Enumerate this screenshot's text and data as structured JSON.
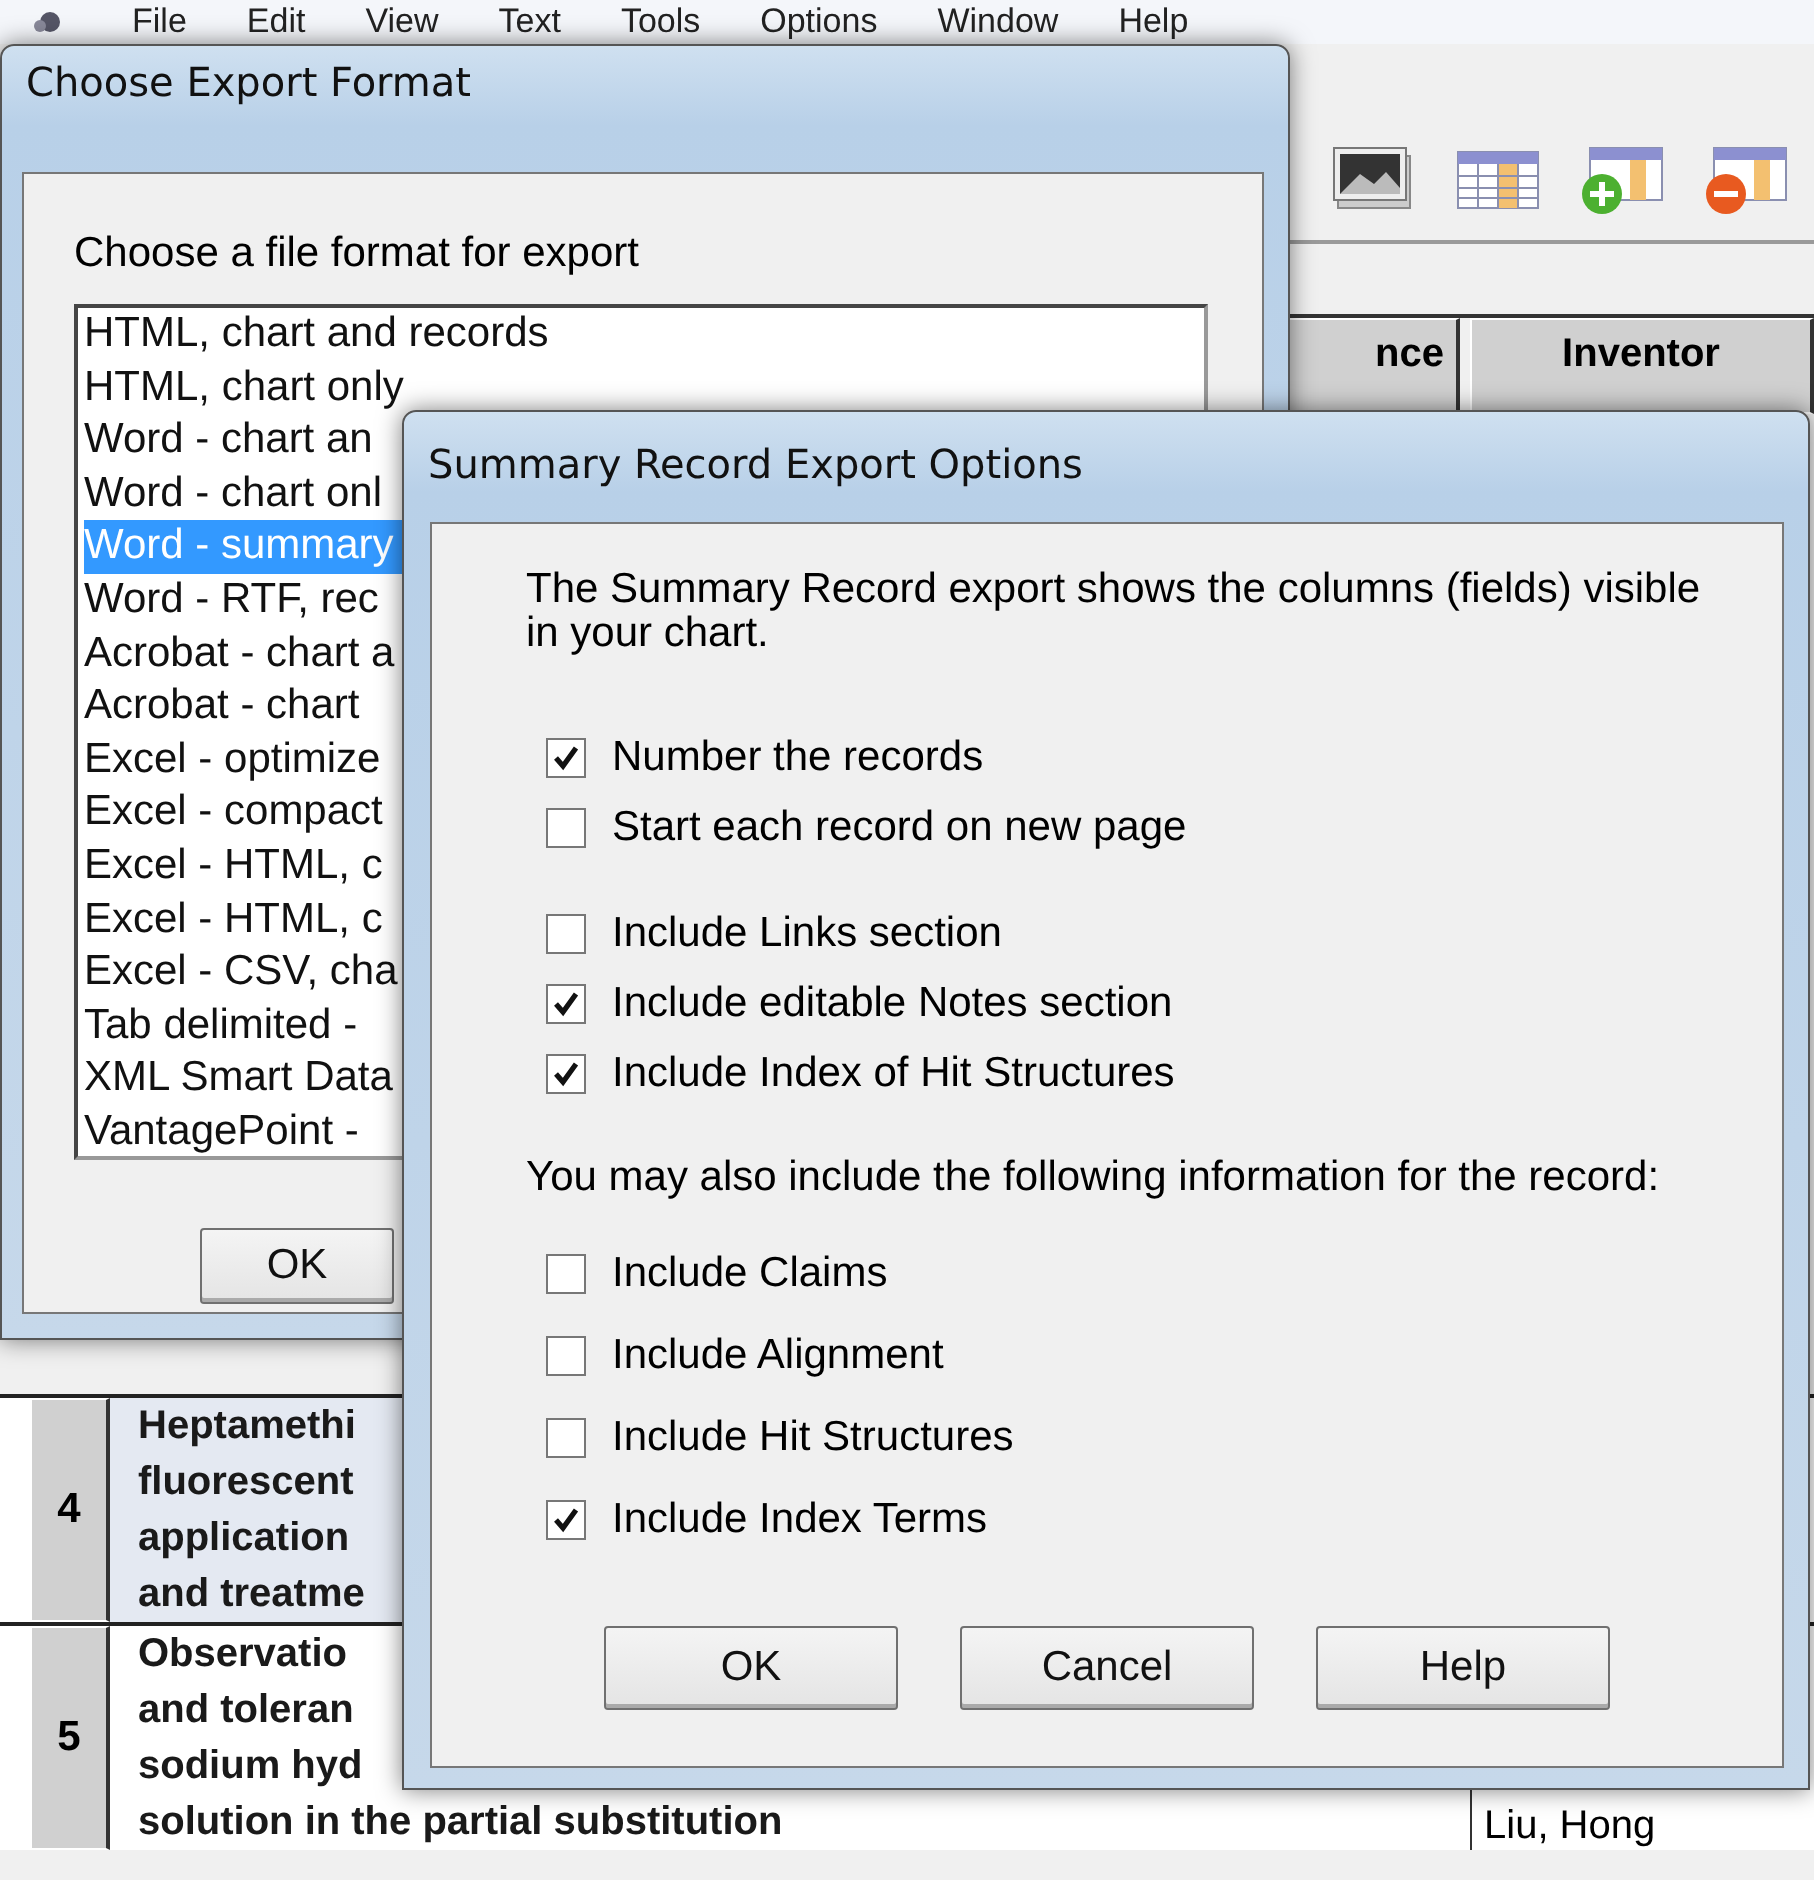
{
  "app": {
    "menu": [
      "File",
      "Edit",
      "View",
      "Text",
      "Tools",
      "Options",
      "Window",
      "Help"
    ],
    "table": {
      "columns": [
        "nce",
        "Inventor"
      ],
      "rows": [
        {
          "number": "4",
          "title_lines": [
            "Heptamethi",
            "fluorescent",
            "application",
            "and treatme"
          ],
          "inventor": "",
          "selected": true
        },
        {
          "number": "5",
          "title_lines": [
            "Observatio",
            "and toleran",
            "sodium hyd",
            "solution in the partial substitution"
          ],
          "inventor": "Liu, Hong",
          "selected": false
        }
      ]
    }
  },
  "export_dialog": {
    "title": "Choose Export Format",
    "prompt": "Choose a file format for export",
    "formats": [
      {
        "label": "HTML, chart and records",
        "selected": false
      },
      {
        "label": "HTML, chart only",
        "selected": false
      },
      {
        "label": "Word - chart an",
        "selected": false
      },
      {
        "label": "Word - chart onl",
        "selected": false
      },
      {
        "label": "Word - summary",
        "selected": true
      },
      {
        "label": "Word - RTF, rec",
        "selected": false
      },
      {
        "label": "Acrobat - chart a",
        "selected": false
      },
      {
        "label": "Acrobat - chart",
        "selected": false
      },
      {
        "label": "Excel - optimize",
        "selected": false
      },
      {
        "label": "Excel - compact",
        "selected": false
      },
      {
        "label": "Excel - HTML, c",
        "selected": false
      },
      {
        "label": "Excel - HTML, c",
        "selected": false
      },
      {
        "label": "Excel - CSV, cha",
        "selected": false
      },
      {
        "label": "Tab delimited -",
        "selected": false
      },
      {
        "label": "XML Smart Data",
        "selected": false
      },
      {
        "label": "VantagePoint -",
        "selected": false
      }
    ],
    "buttons": [
      "OK"
    ]
  },
  "options_dialog": {
    "title": "Summary Record Export Options",
    "description": "The Summary Record export shows the columns (fields) visible in your chart.",
    "sections": [
      {
        "options": [
          {
            "label": "Number the records",
            "checked": true
          },
          {
            "label": "Start each record on new page",
            "checked": false
          }
        ]
      },
      {
        "options": [
          {
            "label": "Include Links section",
            "checked": false
          },
          {
            "label": "Include editable Notes section",
            "checked": true
          },
          {
            "label": "Include Index of Hit Structures",
            "checked": true
          }
        ]
      },
      {
        "heading": "You may also include the following information for the record:",
        "options": [
          {
            "label": "Include Claims",
            "checked": false
          },
          {
            "label": "Include Alignment",
            "checked": false
          },
          {
            "label": "Include Hit Structures",
            "checked": false
          },
          {
            "label": "Include Index Terms",
            "checked": true
          }
        ]
      }
    ],
    "buttons": [
      "OK",
      "Cancel",
      "Help"
    ]
  }
}
